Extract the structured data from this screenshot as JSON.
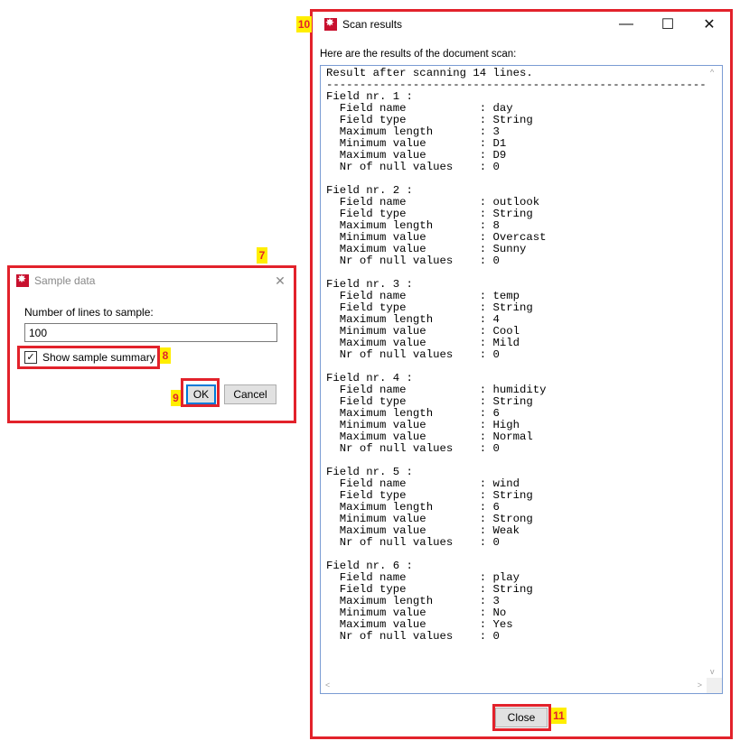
{
  "sample_dialog": {
    "title": "Sample data",
    "close_glyph": "✕",
    "lines_label": "Number of lines to sample:",
    "lines_value": "100",
    "summary_label": "Show sample summary",
    "summary_checked": true,
    "ok_label": "OK",
    "cancel_label": "Cancel"
  },
  "scan_window": {
    "title": "Scan results",
    "minimize_glyph": "—",
    "maximize_glyph": "☐",
    "close_glyph": "✕",
    "intro_text": "Here are the results of the document scan:",
    "close_button_label": "Close",
    "result_text": "Result after scanning 14 lines.\n-------------------------------------------------------------\nField nr. 1 :\n  Field name           : day\n  Field type           : String\n  Maximum length       : 3\n  Minimum value        : D1\n  Maximum value        : D9\n  Nr of null values    : 0\n\nField nr. 2 :\n  Field name           : outlook\n  Field type           : String\n  Maximum length       : 8\n  Minimum value        : Overcast\n  Maximum value        : Sunny\n  Nr of null values    : 0\n\nField nr. 3 :\n  Field name           : temp\n  Field type           : String\n  Maximum length       : 4\n  Minimum value        : Cool\n  Maximum value        : Mild\n  Nr of null values    : 0\n\nField nr. 4 :\n  Field name           : humidity\n  Field type           : String\n  Maximum length       : 6\n  Minimum value        : High\n  Maximum value        : Normal\n  Nr of null values    : 0\n\nField nr. 5 :\n  Field name           : wind\n  Field type           : String\n  Maximum length       : 6\n  Minimum value        : Strong\n  Maximum value        : Weak\n  Nr of null values    : 0\n\nField nr. 6 :\n  Field name           : play\n  Field type           : String\n  Maximum length       : 3\n  Minimum value        : No\n  Maximum value        : Yes\n  Nr of null values    : 0"
  },
  "annotations": {
    "n7": "7",
    "n8": "8",
    "n9": "9",
    "n10": "10",
    "n11": "11"
  },
  "colors": {
    "highlight": "#e2222b",
    "badge_bg": "#ffee00",
    "app_icon": "#c8102e",
    "default_button_border": "#0078d7"
  },
  "icons": {
    "app": "kettle-spoon-icon",
    "checkbox": "checkmark-icon"
  }
}
